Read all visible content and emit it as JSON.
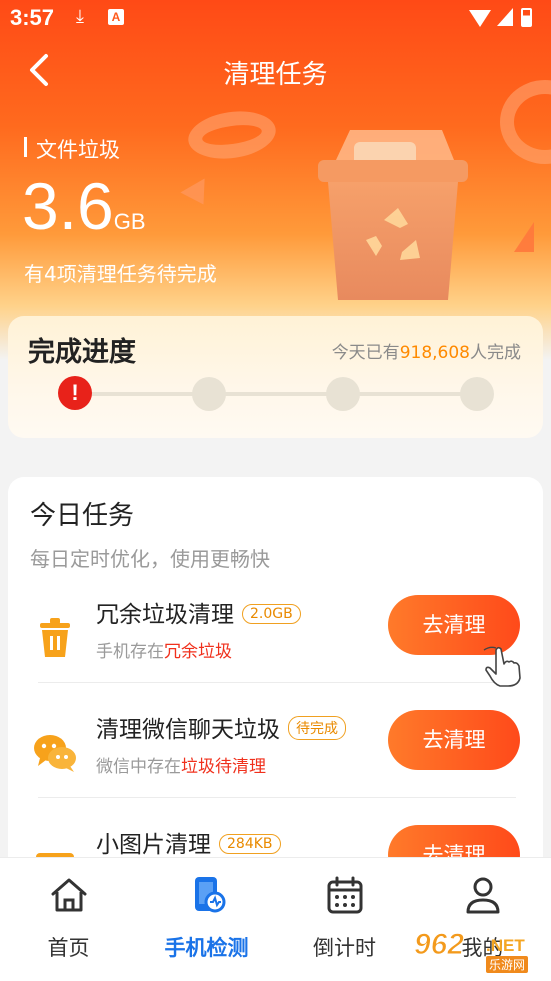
{
  "status_bar": {
    "time": "3:57",
    "icons": [
      "download-icon",
      "a-badge-icon",
      "wifi-icon",
      "signal-icon",
      "battery-icon"
    ],
    "a_badge": "A"
  },
  "header": {
    "title": "清理任务",
    "back_icon": "chevron-left-icon"
  },
  "summary": {
    "label": "文件垃圾",
    "size_value": "3.6",
    "size_unit": "GB",
    "pending_text": "有4项清理任务待完成"
  },
  "progress": {
    "title": "完成进度",
    "today_prefix": "今天已有",
    "today_count": "918,608",
    "today_suffix": "人完成",
    "alert_symbol": "!",
    "steps_total": 4,
    "current_step": 1
  },
  "today_tasks": {
    "title": "今日任务",
    "subtitle": "每日定时优化，使用更畅快",
    "items": [
      {
        "icon": "trash-icon",
        "name": "冗余垃圾清理",
        "badge": "2.0GB",
        "desc_prefix": "手机存在",
        "desc_highlight": "冗余垃圾",
        "button": "去清理"
      },
      {
        "icon": "wechat-icon",
        "name": "清理微信聊天垃圾",
        "badge": "待完成",
        "desc_prefix": "微信中存在",
        "desc_highlight": "垃圾待清理",
        "button": "去清理"
      },
      {
        "icon": "image-icon",
        "name": "小图片清理",
        "badge": "284KB",
        "desc_prefix": "",
        "desc_highlight": "",
        "button": "去清理"
      }
    ]
  },
  "bottom_nav": {
    "items": [
      {
        "label": "首页",
        "icon": "home-icon",
        "active": false
      },
      {
        "label": "手机检测",
        "icon": "phone-check-icon",
        "active": true
      },
      {
        "label": "倒计时",
        "icon": "calendar-icon",
        "active": false
      },
      {
        "label": "我的",
        "icon": "user-icon",
        "active": false
      }
    ]
  },
  "watermark": {
    "number": "962",
    "net": ".NET",
    "sub": "乐游网"
  },
  "colors": {
    "accent": "#ff5a1c",
    "nav_active": "#1a73e8",
    "highlight": "#f0301c",
    "badge": "#e98a00"
  }
}
